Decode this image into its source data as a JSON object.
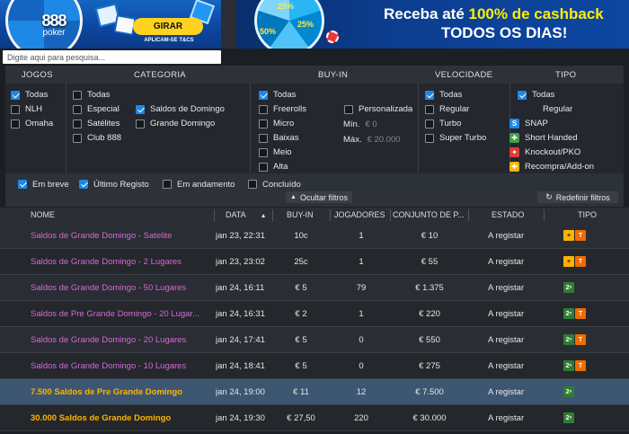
{
  "banner_left": {
    "logo_big": "888",
    "logo_small": "poker",
    "button": "GIRAR",
    "terms": "APLICAM-SE T&CS"
  },
  "banner_right": {
    "line1_pre": "Receba até ",
    "line1_hl": "100% de cashback",
    "line2": "TODOS OS DIAS!",
    "dial": [
      "25%",
      "50%",
      "25%"
    ]
  },
  "search": {
    "placeholder": "Digite aqui para pesquisa..."
  },
  "filters": {
    "headers": {
      "jogos": "JOGOS",
      "categoria": "CATEGORIA",
      "buyin": "BUY-IN",
      "velocidade": "VELOCIDADE",
      "tipo": "TIPO"
    },
    "jogos": [
      {
        "label": "Todas",
        "checked": true
      },
      {
        "label": "NLH",
        "checked": false
      },
      {
        "label": "Omaha",
        "checked": false
      }
    ],
    "categoria_col1": [
      {
        "label": "Todas",
        "checked": false
      },
      {
        "label": "Especial",
        "checked": false
      },
      {
        "label": "Satélites",
        "checked": false
      },
      {
        "label": "Club 888",
        "checked": false
      }
    ],
    "categoria_col2": [
      {
        "label": "Saldos de Domingo",
        "checked": true
      },
      {
        "label": "Grande Domingo",
        "checked": false
      }
    ],
    "buyin": [
      {
        "label": "Todas",
        "checked": true
      },
      {
        "label": "Freerolls",
        "checked": false
      },
      {
        "label": "Micro",
        "checked": false
      },
      {
        "label": "Baixas",
        "checked": false
      },
      {
        "label": "Meio",
        "checked": false
      },
      {
        "label": "Alta",
        "checked": false
      }
    ],
    "custom": {
      "label": "Personalizada",
      "min_label": "Mín.",
      "min_val": "€ 0",
      "max_label": "Máx.",
      "max_val": "€ 20.000"
    },
    "velocidade": [
      {
        "label": "Todas",
        "checked": true
      },
      {
        "label": "Regular",
        "checked": false
      },
      {
        "label": "Turbo",
        "checked": false
      },
      {
        "label": "Super Turbo",
        "checked": false
      }
    ],
    "tipo_all": {
      "label": "Todas",
      "checked": true
    },
    "tipo": [
      {
        "label": "Regular",
        "icon": "",
        "color": ""
      },
      {
        "label": "SNAP",
        "icon": "snap-icon",
        "color": "#1e88e5",
        "glyph": "S"
      },
      {
        "label": "Short Handed",
        "icon": "short-handed-icon",
        "color": "#43a047",
        "glyph": "✚"
      },
      {
        "label": "Knockout/PKO",
        "icon": "knockout-icon",
        "color": "#e53935",
        "glyph": "✦"
      },
      {
        "label": "Recompra/Add-on",
        "icon": "rebuy-icon",
        "color": "#ffb300",
        "glyph": "✚"
      }
    ],
    "status": [
      {
        "label": "Em breve",
        "checked": true
      },
      {
        "label": "Último Registo",
        "checked": true
      },
      {
        "label": "Em andamento",
        "checked": false
      },
      {
        "label": "Concluído",
        "checked": false
      }
    ],
    "hide_button": "Ocultar filtros",
    "reset_button": "Redefinir filtros"
  },
  "table": {
    "columns": {
      "nome": "NOME",
      "data": "DATA",
      "buyin": "BUY-IN",
      "jogadores": "JOGADORES",
      "conjunto": "CONJUNTO DE P...",
      "estado": "ESTADO",
      "tipo": "TIPO"
    },
    "rows": [
      {
        "nome": "Saldos de Grande Domingo - Satelite",
        "data": "jan 23, 22:31",
        "buyin": "10c",
        "jogadores": "1",
        "conjunto": "€ 10",
        "estado": "A registar",
        "badges": [
          "rebuy",
          "turbo"
        ],
        "style": "normal"
      },
      {
        "nome": "Saldos de Grande Domingo - 2 Lugares",
        "data": "jan 23, 23:02",
        "buyin": "25c",
        "jogadores": "1",
        "conjunto": "€ 55",
        "estado": "A registar",
        "badges": [
          "rebuy",
          "turbo"
        ],
        "style": "normal"
      },
      {
        "nome": "Saldos de Grande Domingo - 50 Lugares",
        "data": "jan 24, 16:11",
        "buyin": "€ 5",
        "jogadores": "79",
        "conjunto": "€ 1.375",
        "estado": "A registar",
        "badges": [
          "second"
        ],
        "style": "normal"
      },
      {
        "nome": "Saldos de Pre Grande Domingo - 20 Lugar...",
        "data": "jan 24, 16:31",
        "buyin": "€ 2",
        "jogadores": "1",
        "conjunto": "€ 220",
        "estado": "A registar",
        "badges": [
          "second",
          "turbo"
        ],
        "style": "normal"
      },
      {
        "nome": "Saldos de Grande Domingo - 20 Lugares",
        "data": "jan 24, 17:41",
        "buyin": "€ 5",
        "jogadores": "0",
        "conjunto": "€ 550",
        "estado": "A registar",
        "badges": [
          "second",
          "turbo"
        ],
        "style": "normal"
      },
      {
        "nome": "Saldos de Grande Domingo - 10 Lugares",
        "data": "jan 24, 18:41",
        "buyin": "€ 5",
        "jogadores": "0",
        "conjunto": "€ 275",
        "estado": "A registar",
        "badges": [
          "second",
          "turbo"
        ],
        "style": "normal"
      },
      {
        "nome": "7.500 Saldos de Pre Grande Domingo",
        "data": "jan 24, 19:00",
        "buyin": "€ 11",
        "jogadores": "12",
        "conjunto": "€ 7.500",
        "estado": "A registar",
        "badges": [
          "second"
        ],
        "style": "selected"
      },
      {
        "nome": "30.000 Saldos de Grande Domingo",
        "data": "jan 24, 19:30",
        "buyin": "€ 27,50",
        "jogadores": "220",
        "conjunto": "€ 30.000",
        "estado": "A registar",
        "badges": [
          "second"
        ],
        "style": "gold"
      }
    ]
  },
  "colors": {
    "accent": "#1e88e5",
    "name_pink": "#d46bd6",
    "name_gold": "#ffb300",
    "selected_row": "#3d5773"
  }
}
